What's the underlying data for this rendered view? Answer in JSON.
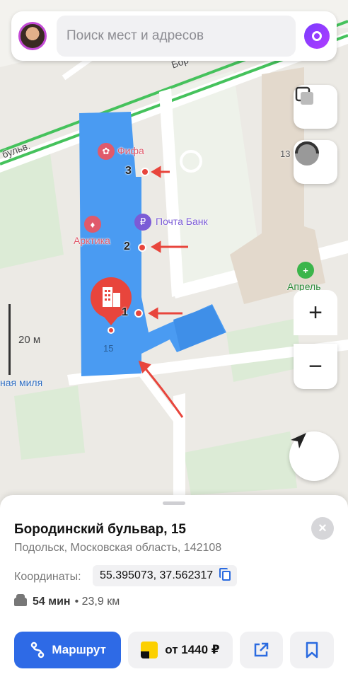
{
  "search": {
    "placeholder": "Поиск мест и адресов"
  },
  "map": {
    "streets": [
      "бульв.",
      "Бор"
    ],
    "pois": [
      {
        "name": "Фифа",
        "icon": "lotus-icon",
        "color": "#e05a6b"
      },
      {
        "name": "Почта Банк",
        "icon": "bank-icon",
        "color": "#7b5bd6"
      },
      {
        "name": "Арктика",
        "icon": "tooth-icon",
        "color": "#e05a6b"
      },
      {
        "name": "Апрель",
        "icon": "pharmacy-cross-icon",
        "color": "#3bb54a"
      }
    ],
    "entrances": [
      "3",
      "2",
      "1"
    ],
    "house_numbers": [
      "13",
      "15"
    ],
    "partial_label": "ная миля",
    "scale_label": "20 м",
    "building_color": "#4a9bf2",
    "marker_color": "#e8453c"
  },
  "controls": {
    "layers": "layers-icon",
    "traffic": "traffic-gauge-icon",
    "zoom_in": "+",
    "zoom_out": "−",
    "locate": "navigation-arrow-icon"
  },
  "place": {
    "title": "Бородинский бульвар, 15",
    "address": "Подольск, Московская область, 142108",
    "coords_label": "Координаты:",
    "coords": "55.395073, 37.562317",
    "drive_time": "54 мин",
    "distance": "• 23,9 км"
  },
  "actions": {
    "route": "Маршрут",
    "taxi": "от 1440 ₽"
  }
}
